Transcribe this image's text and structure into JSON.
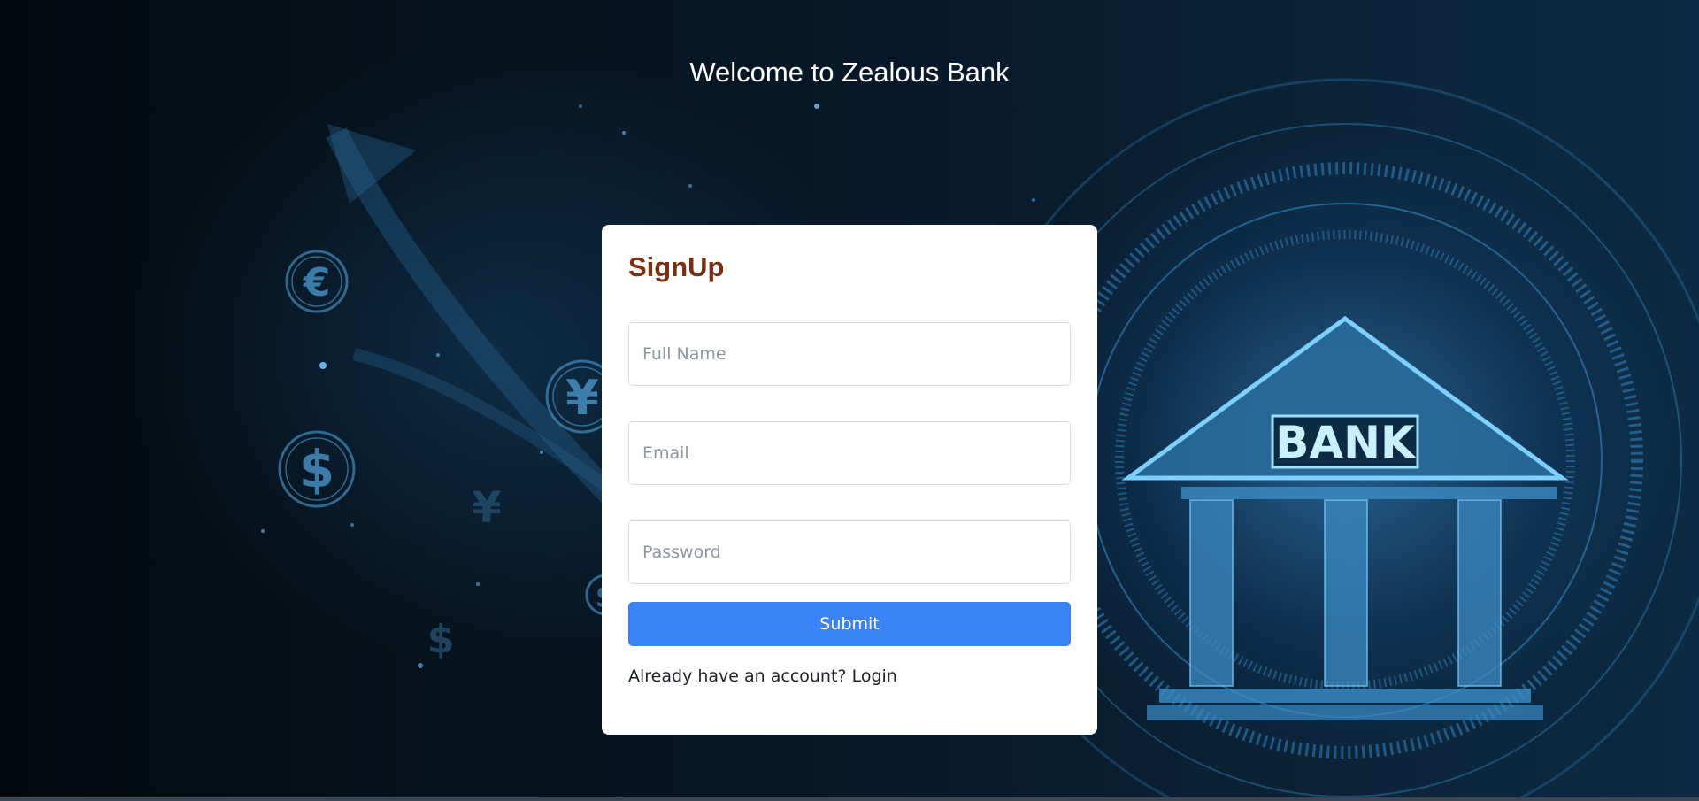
{
  "page": {
    "headline": "Welcome to Zealous Bank"
  },
  "background": {
    "bank_sign": "BANK",
    "currency_symbols": [
      "€",
      "¥",
      "$",
      "$",
      "¥",
      "$"
    ]
  },
  "signup_form": {
    "title": "SignUp",
    "full_name": {
      "value": "",
      "placeholder": "Full Name"
    },
    "email": {
      "value": "",
      "placeholder": "Email"
    },
    "password": {
      "value": "",
      "placeholder": "Password"
    },
    "submit_label": "Submit",
    "login_prompt": "Already have an account?",
    "login_link": "Login"
  },
  "colors": {
    "title": "#7a2e12",
    "submit_button": "#3b82f6",
    "card": "#ffffff",
    "headline": "#ffffff"
  }
}
